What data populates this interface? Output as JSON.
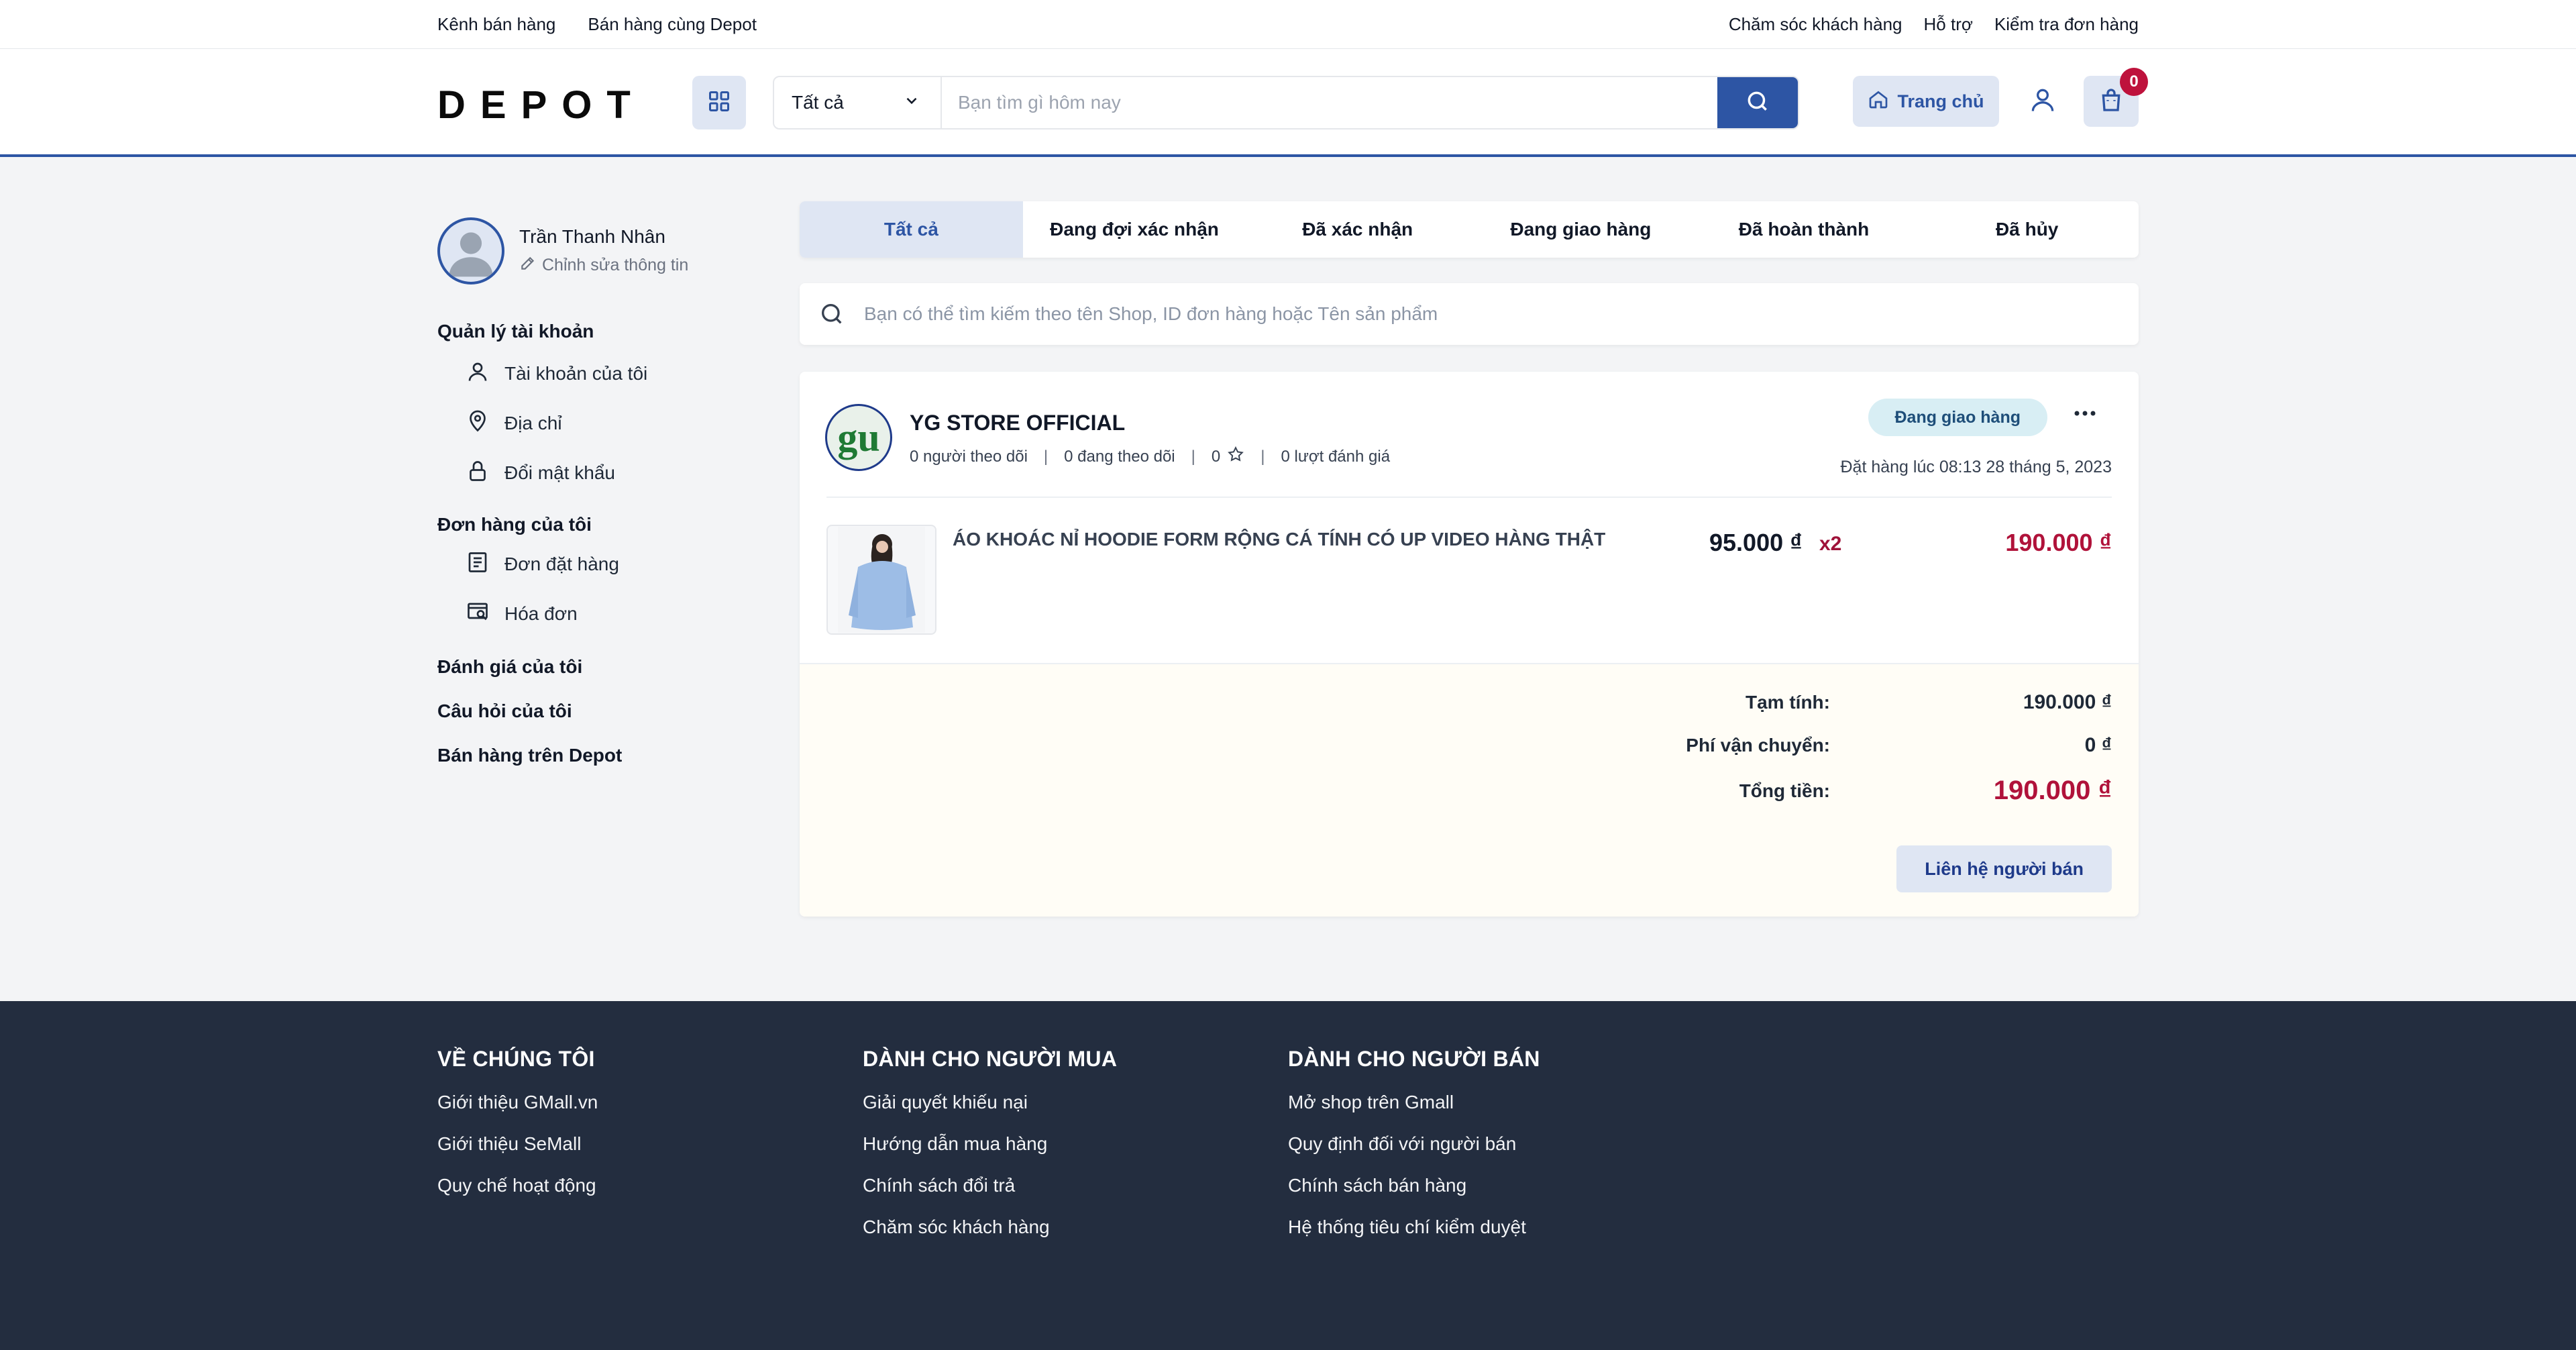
{
  "topbar": {
    "left_links": [
      "Kênh bán hàng",
      "Bán hàng cùng Depot"
    ],
    "right_links": [
      "Chăm sóc khách hàng",
      "Hỗ trợ",
      "Kiểm tra đơn hàng"
    ]
  },
  "header": {
    "logo": "DEPOT",
    "category_selected": "Tất cả",
    "search_placeholder": "Bạn tìm gì hôm nay",
    "home_label": "Trang chủ",
    "cart_count": "0"
  },
  "sidebar": {
    "user_name": "Trần Thanh Nhân",
    "edit_profile": "Chỉnh sửa thông tin",
    "account_section": "Quản lý tài khoản",
    "account_items": [
      "Tài khoản của tôi",
      "Địa chỉ",
      "Đổi mật khẩu"
    ],
    "orders_section": "Đơn hàng của tôi",
    "order_items": [
      "Đơn đặt hàng",
      "Hóa đơn"
    ],
    "reviews": "Đánh giá của tôi",
    "questions": "Câu hỏi của tôi",
    "sell": "Bán hàng trên Depot"
  },
  "tabs": [
    "Tất cả",
    "Đang đợi xác nhận",
    "Đã xác nhận",
    "Đang giao hàng",
    "Đã hoàn thành",
    "Đã hủy"
  ],
  "order_search_placeholder": "Bạn có thể tìm kiếm theo tên Shop, ID đơn hàng hoặc Tên sản phẩm",
  "order": {
    "shop_logo_text": "gu",
    "shop_name": "YG STORE OFFICIAL",
    "followers": "0 người theo dõi",
    "following": "0 đang theo dõi",
    "rating": "0",
    "reviews": "0 lượt đánh giá",
    "status": "Đang giao hàng",
    "order_time": "Đặt hàng lúc 08:13 28 tháng 5, 2023",
    "product_name": "ÁO KHOÁC NỈ HOODIE FORM RỘNG CÁ TÍNH CÓ UP VIDEO HÀNG THẬT",
    "unit_price": "95.000 ₫",
    "quantity": "x2",
    "line_total": "190.000 ₫",
    "subtotal_label": "Tạm tính:",
    "subtotal": "190.000 ₫",
    "shipping_label": "Phí vận chuyển:",
    "shipping": "0 ₫",
    "total_label": "Tổng tiền:",
    "total": "190.000 ₫",
    "contact_label": "Liên hệ người bán"
  },
  "footer": {
    "col1_title": "VỀ CHÚNG TÔI",
    "col1_links": [
      "Giới thiệu GMall.vn",
      "Giới thiệu SeMall",
      "Quy chế hoạt động"
    ],
    "col2_title": "DÀNH CHO NGƯỜI MUA",
    "col2_links": [
      "Giải quyết khiếu nại",
      "Hướng dẫn mua hàng",
      "Chính sách đổi trả",
      "Chăm sóc khách hàng"
    ],
    "col3_title": "DÀNH CHO NGƯỜI BÁN",
    "col3_links": [
      "Mở shop trên Gmall",
      "Quy định đối với người bán",
      "Chính sách bán hàng",
      "Hệ thống tiêu chí kiểm duyệt"
    ]
  },
  "colors": {
    "brand": "#2d55a4",
    "accent_light": "#dfe6f3",
    "price_red": "#b0123a",
    "footer_bg": "#232d3f"
  }
}
